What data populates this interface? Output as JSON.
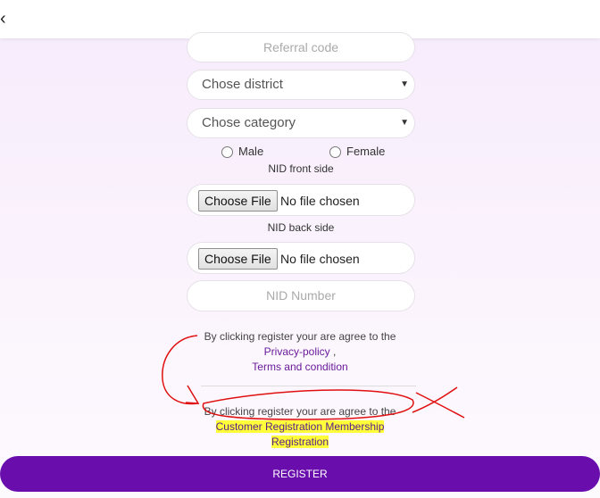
{
  "header": {
    "back_icon": "chevron-left-icon",
    "back_glyph": "‹"
  },
  "form": {
    "referral_placeholder": "Referral code",
    "district_select": "Chose district",
    "category_select": "Chose category",
    "gender_options": [
      "Male",
      "Female"
    ],
    "nid_front_label": "NID front side",
    "nid_back_label": "NID back side",
    "file_button_label": "Choose File",
    "file_status": "No file chosen",
    "nid_number_placeholder": "NID Number"
  },
  "agreement1": {
    "text": "By clicking register your are agree to the",
    "privacy_link": "Privacy-policy",
    "separator": " ,",
    "terms_link": "Terms and condition"
  },
  "agreement2": {
    "text": "By clicking register your are agree to the",
    "link_line1": "Customer Registration Membership",
    "link_line2": "Registration"
  },
  "register_button": "REGISTER",
  "colors": {
    "accent": "#6a0dad",
    "link": "#6a1b9a",
    "annotation": "#e01010",
    "highlight": "#ffff3a"
  }
}
